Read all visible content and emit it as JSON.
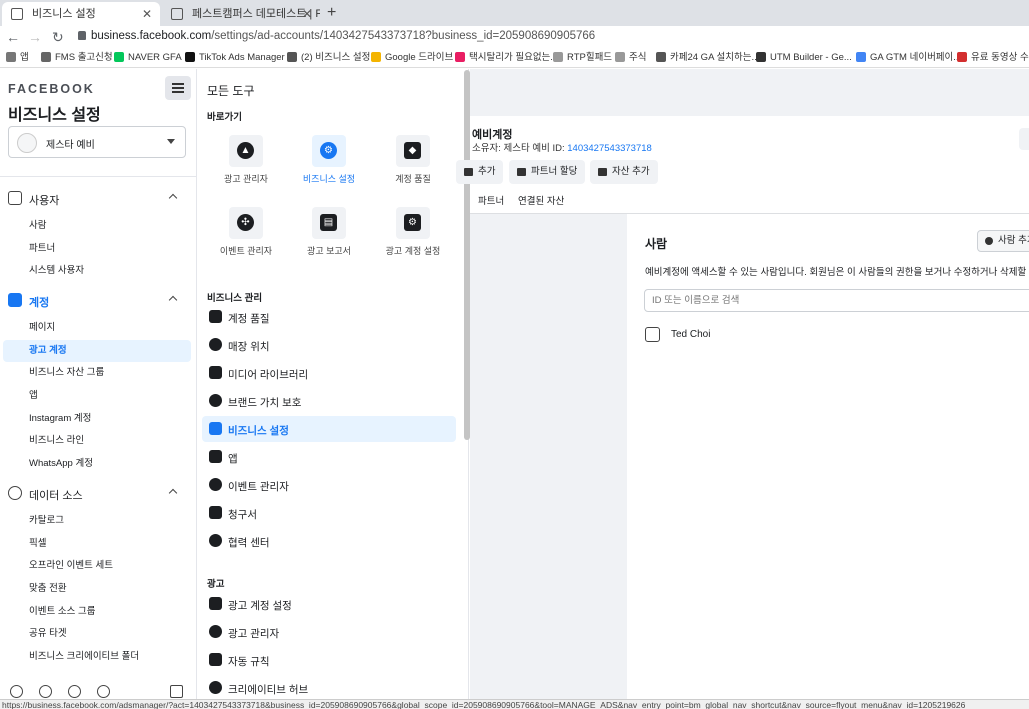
{
  "browser": {
    "tabs": [
      {
        "title": "비즈니스 설정",
        "active": true
      },
      {
        "title": "페스트캠퍼스 데모테스트 | Faceboo",
        "active": false
      }
    ],
    "url_host": "business.facebook.com",
    "url_path": "/settings/ad-accounts/1403427543373718?business_id=205908690905766",
    "bookmarks": [
      "앱",
      "FMS 출고신청",
      "NAVER GFA",
      "TikTok Ads Manager",
      "(2) 비즈니스 설정",
      "Google 드라이브",
      "택시탈리가 필요없는...",
      "RTP힐패드",
      "주식",
      "카페24 GA 설치하는...",
      "UTM Builder - Ge...",
      "GA GTM 네이버페이...",
      "유료 동영상 수집"
    ],
    "status_url": "https://business.facebook.com/adsmanager/?act=1403427543373718&business_id=205908690905766&global_scope_id=205908690905766&tool=MANAGE_ADS&nav_entry_point=bm_global_nav_shortcut&nav_source=flyout_menu&nav_id=1205219626"
  },
  "sidebar": {
    "logo": "FACEBOOK",
    "title": "비즈니스 설정",
    "account": "제스타 예비",
    "sections": [
      {
        "label": "사용자",
        "items": [
          "사람",
          "파트너",
          "시스템 사용자"
        ]
      },
      {
        "label": "계정",
        "items": [
          "페이지",
          "광고 계정",
          "비즈니스 자산 그룹",
          "앱",
          "Instagram 계정",
          "비즈니스 라인",
          "WhatsApp 계정"
        ],
        "active_item": "광고 계정"
      },
      {
        "label": "데이터 소스",
        "items": [
          "카탈로그",
          "픽셀",
          "오프라인 이벤트 세트",
          "맞춤 전환",
          "이벤트 소스 그룹",
          "공유 타겟",
          "비즈니스 크리에이티브 폴더"
        ]
      }
    ]
  },
  "tools": {
    "title": "모든 도구",
    "shortcuts_label": "바로가기",
    "shortcuts": [
      {
        "label": "광고 관리자",
        "icon": "ads-manager-icon",
        "glyph": "▲"
      },
      {
        "label": "비즈니스 설정",
        "icon": "gear-icon",
        "glyph": "⚙",
        "active": true
      },
      {
        "label": "계정 품질",
        "icon": "shield-icon",
        "glyph": "◆"
      },
      {
        "label": "이벤트 관리자",
        "icon": "events-icon",
        "glyph": "✣"
      },
      {
        "label": "광고 보고서",
        "icon": "report-icon",
        "glyph": "▤"
      },
      {
        "label": "광고 계정 설정",
        "icon": "ad-account-settings-icon",
        "glyph": "⚙"
      }
    ],
    "biz_label": "비즈니스 관리",
    "biz_items": [
      "계정 품질",
      "매장 위치",
      "미디어 라이브러리",
      "브랜드 가치 보호",
      "비즈니스 설정",
      "앱",
      "이벤트 관리자",
      "청구서",
      "협력 센터"
    ],
    "biz_active": "비즈니스 설정",
    "ads_label": "광고",
    "ads_items": [
      "광고 계정 설정",
      "광고 관리자",
      "자동 규칙",
      "크리에이티브 허브"
    ]
  },
  "main": {
    "account_name": "예비계정",
    "owner_prefix": "소유자: 제스타 예비  ID:",
    "account_id": "1403427543373718",
    "buttons": [
      "추가",
      "파트너 할당",
      "자산 추가"
    ],
    "tabs": [
      "파트너",
      "연결된 자산"
    ],
    "people_title": "사람",
    "add_person": "사람 추가",
    "description": "예비계정에 액세스할 수 있는 사람입니다. 회원님은 이 사람들의 권한을 보거나 수정하거나 삭제할 수 있습니다.",
    "search_placeholder": "ID 또는 이름으로 검색",
    "person_name": "Ted Choi"
  },
  "colors": {
    "accent": "#1877f2",
    "active_bg": "#e7f3ff",
    "panel_bg": "#f0f2f5"
  }
}
